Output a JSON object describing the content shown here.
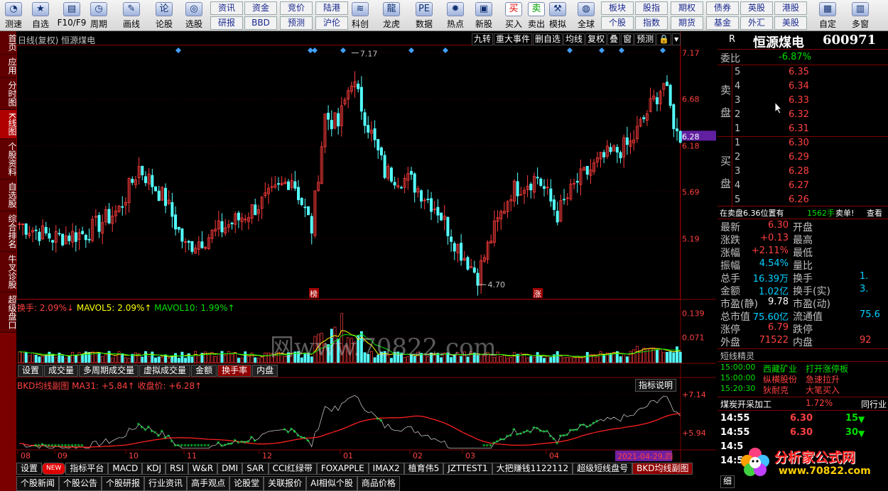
{
  "toolbar": {
    "buttons": [
      {
        "label": "测速",
        "icon": "speedometer-icon"
      },
      {
        "label": "自选",
        "icon": "star-icon"
      },
      {
        "label": "F10/F9",
        "icon": "f10-icon"
      },
      {
        "label": "周期",
        "icon": "clock-icon"
      },
      {
        "label": "画线",
        "icon": "pencil-icon"
      },
      {
        "label": "论股",
        "icon": "discuss-icon"
      },
      {
        "label": "选股",
        "icon": "chart-search-icon"
      },
      {
        "label": "科创",
        "icon": "kechuang-icon"
      },
      {
        "label": "龙虎",
        "icon": "dragon-icon"
      },
      {
        "label": "数据",
        "icon": "pe-icon"
      },
      {
        "label": "热点",
        "icon": "hot-icon"
      },
      {
        "label": "新股",
        "icon": "newstock-icon"
      },
      {
        "label": "买入",
        "icon": "buy-icon"
      },
      {
        "label": "卖出",
        "icon": "sell-icon"
      },
      {
        "label": "模拟",
        "icon": "hammer-icon"
      },
      {
        "label": "全球",
        "icon": "globe-icon"
      },
      {
        "label": "自定",
        "icon": "custom-icon"
      },
      {
        "label": "多窗",
        "icon": "multiwindow-icon"
      }
    ],
    "small_top": [
      "资讯",
      "资金",
      "竞价",
      "陆港",
      "板块",
      "股指",
      "期权",
      "债券",
      "英股",
      "港股"
    ],
    "small_bottom": [
      "研报",
      "BBD",
      "预测",
      "沪伦",
      "个股",
      "指数",
      "期货",
      "基金",
      "外汇",
      "美股"
    ]
  },
  "sidebar": [
    "首页",
    "应用",
    "分时图",
    "K线图",
    "个股资料",
    "自选股",
    "综合排名",
    "牛叉诊股",
    "超级盘口"
  ],
  "chart": {
    "title": "日线(复权) 恒源煤电",
    "menu": [
      "九转",
      "重大事件",
      "删自选",
      "均线",
      "复权",
      "叠",
      "窗",
      "预测",
      "🔒",
      "▾"
    ],
    "price_labels": [
      "7.17",
      "6.68",
      "6.28",
      "6.18",
      "5.69",
      "5.19"
    ],
    "high_label": "7.17",
    "low_label": "4.70",
    "tag_bang": "榜",
    "tag_zhang": "涨",
    "vol_header": {
      "a": "换手: 2.09%↓",
      "b": "MAVOL5: 2.09%↑",
      "c": "MAVOL10: 1.99%↑"
    },
    "vol_labels": [
      "0.139",
      "0.071"
    ],
    "vol_tabs": [
      "设置",
      "成交量",
      "多周期成交量",
      "虚拟成交量",
      "金额",
      "换手率",
      "内盘"
    ],
    "ind_header": {
      "a": "BKD均线副图",
      "b": "MA31: +5.84↑",
      "c": "收盘价: +6.28↑"
    },
    "ind_btn": "指标说明",
    "ind_labels": [
      "+7.14",
      "+5.94"
    ],
    "months": [
      "08",
      "09",
      "10",
      "11",
      "12",
      "01",
      "02",
      "03",
      "04"
    ],
    "date_badge": "2021-04-29,四"
  },
  "bottom_tabs": [
    "设置",
    "NEW",
    "指标平台",
    "MACD",
    "KDJ",
    "RSI",
    "W&R",
    "DMI",
    "SAR",
    "CCI红绿带",
    "FOXAPPLE",
    "IMAX2",
    "植育伟5",
    "JZTTEST1",
    "大把赚钱1122112",
    "超级短线盘号",
    "BKD均线副图"
  ],
  "bottom_tabs2": [
    "个股新闻",
    "个股公告",
    "个股研报",
    "行业资讯",
    "高手观点",
    "论股堂",
    "关联报价",
    "AI相似个股",
    "商品价格"
  ],
  "right": {
    "badge": "R",
    "name": "恒源煤电",
    "code": "600971",
    "weibi_label": "委比",
    "weibi_value": "-6.87%",
    "sell_label": [
      "卖",
      "盘"
    ],
    "buy_label": [
      "买",
      "盘"
    ],
    "asks": [
      {
        "lvl": "5",
        "price": "6.35"
      },
      {
        "lvl": "4",
        "price": "6.34"
      },
      {
        "lvl": "3",
        "price": "6.33"
      },
      {
        "lvl": "2",
        "price": "6.32"
      },
      {
        "lvl": "1",
        "price": "6.31"
      }
    ],
    "bids": [
      {
        "lvl": "1",
        "price": "6.30"
      },
      {
        "lvl": "2",
        "price": "6.29"
      },
      {
        "lvl": "3",
        "price": "6.28"
      },
      {
        "lvl": "4",
        "price": "6.27"
      },
      {
        "lvl": "5",
        "price": "6.26"
      }
    ],
    "notice": {
      "a": "在卖盘6.36位置有",
      "b": "1562手",
      "c": "卖单!",
      "d": "查看"
    },
    "stats": [
      {
        "k": "最新",
        "v": "6.30",
        "k2": "开盘",
        "vc": "red"
      },
      {
        "k": "涨跌",
        "v": "+0.13",
        "k2": "最高",
        "vc": "red"
      },
      {
        "k": "涨幅",
        "v": "+2.11%",
        "k2": "最低",
        "vc": "red"
      },
      {
        "k": "振幅",
        "v": "4.54%",
        "k2": "量比",
        "vc": "cyan"
      },
      {
        "k": "总手",
        "v": "16.39万",
        "k2": "换手",
        "vc": "cyan",
        "v2": "1."
      },
      {
        "k": "金额",
        "v": "1.02亿",
        "k2": "换手(实)",
        "vc": "cyan",
        "v2": "3."
      },
      {
        "k": "市盈(静)",
        "v": "9.78",
        "k2": "市盈(动)",
        "vc": "white"
      },
      {
        "k": "总市值",
        "v": "75.60亿",
        "k2": "流通值",
        "vc": "cyan",
        "v2": "75.6"
      },
      {
        "k": "涨停",
        "v": "6.79",
        "k2": "跌停",
        "vc": "red"
      },
      {
        "k": "外盘",
        "v": "71522",
        "k2": "内盘",
        "vc": "red",
        "v2": "92"
      }
    ],
    "spirit_title": "短线精灵",
    "spirit": [
      {
        "t": "15:00:00",
        "n": "西藏矿业",
        "e": "打开涨停板",
        "nc": "green",
        "ec": "green"
      },
      {
        "t": "15:00:00",
        "n": "纵横股份",
        "e": "急速拉升",
        "nc": "red",
        "ec": "red"
      },
      {
        "t": "15:20:30",
        "n": "狄耐克",
        "e": "大笔买入",
        "nc": "red",
        "ec": "red"
      }
    ],
    "industry": {
      "name": "煤炭开采加工",
      "pct": "1.72%",
      "link": "同行业"
    },
    "ticks": [
      {
        "t": "14:55",
        "p": "6.30",
        "v": "15"
      },
      {
        "t": "14:55",
        "p": "6.30",
        "v": "30"
      },
      {
        "t": "14:5",
        "p": "",
        "v": ""
      },
      {
        "t": "14:5",
        "p": "",
        "v": ""
      }
    ],
    "detail_tab": "细"
  },
  "watermark": "网www.70822.com",
  "logo": {
    "title": "分析家公式网",
    "url": "www.70822.com"
  },
  "colors": {
    "up": "#ff3c3c",
    "down": "#54ffff",
    "ma": "#ff2020",
    "panel_border": "#800000"
  }
}
